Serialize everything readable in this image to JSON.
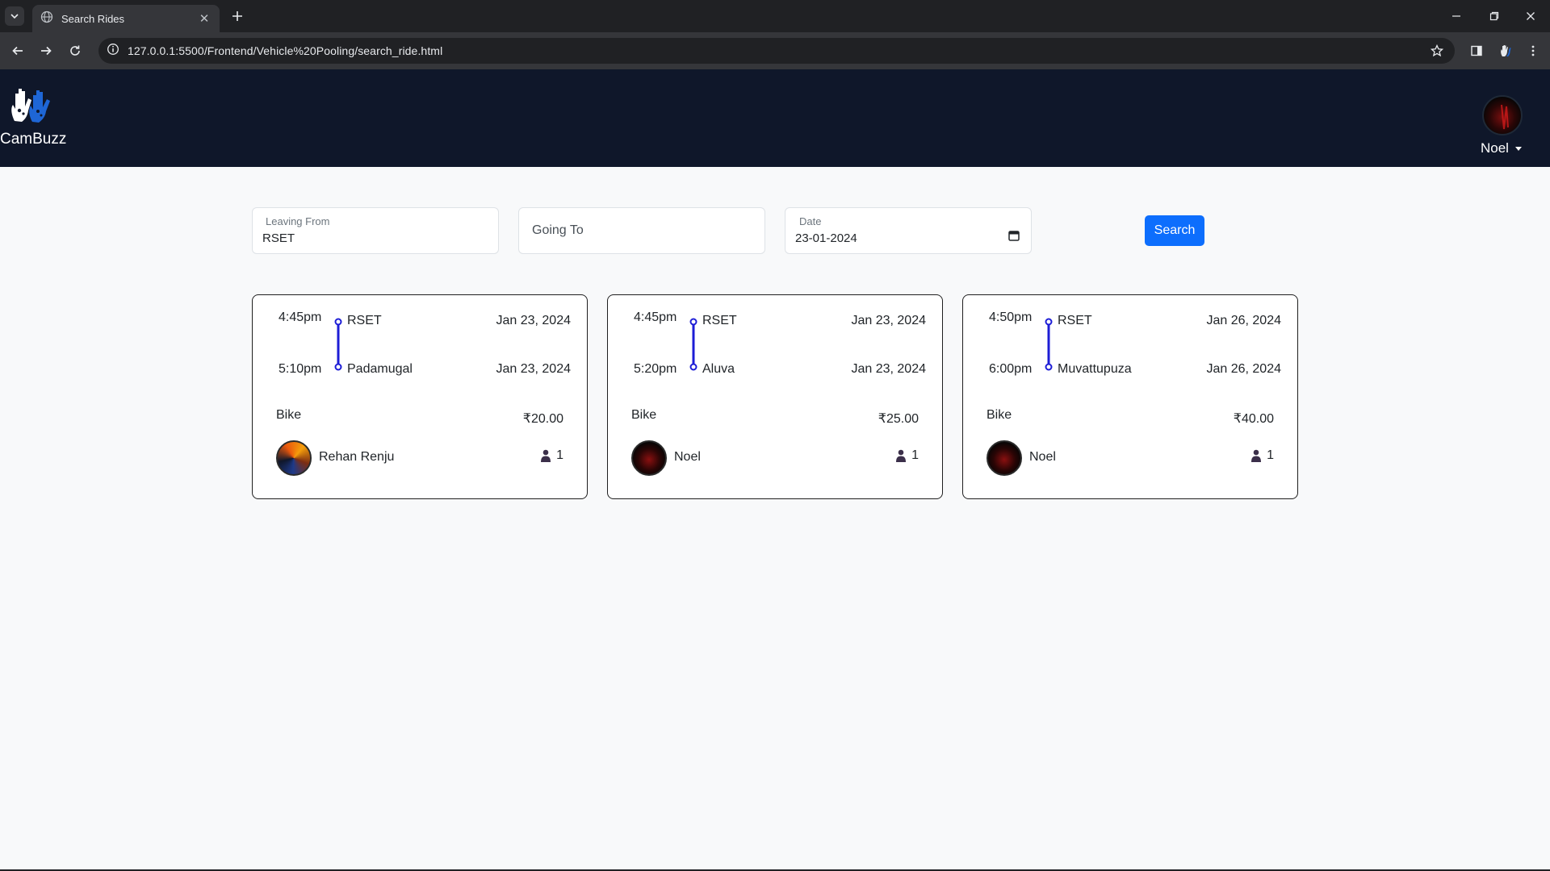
{
  "browser": {
    "tab_title": "Search Rides",
    "url": "127.0.0.1:5500/Frontend/Vehicle%20Pooling/search_ride.html"
  },
  "site": {
    "brand": "CamBuzz",
    "user_name": "Noel"
  },
  "search": {
    "leaving_from_label": "Leaving From",
    "leaving_from_value": "RSET",
    "going_to_placeholder": "Going To",
    "date_label": "Date",
    "date_value": "23-01-2024",
    "button_label": "Search"
  },
  "rides": [
    {
      "start_time": "4:45pm",
      "start_place": "RSET",
      "start_date": "Jan 23, 2024",
      "end_time": "5:10pm",
      "end_place": "Padamugal",
      "end_date": "Jan 23, 2024",
      "vehicle": "Bike",
      "price": "₹20.00",
      "driver": "Rehan Renju",
      "seats": "1"
    },
    {
      "start_time": "4:45pm",
      "start_place": "RSET",
      "start_date": "Jan 23, 2024",
      "end_time": "5:20pm",
      "end_place": "Aluva",
      "end_date": "Jan 23, 2024",
      "vehicle": "Bike",
      "price": "₹25.00",
      "driver": "Noel",
      "seats": "1"
    },
    {
      "start_time": "4:50pm",
      "start_place": "RSET",
      "start_date": "Jan 26, 2024",
      "end_time": "6:00pm",
      "end_place": "Muvattupuza",
      "end_date": "Jan 26, 2024",
      "vehicle": "Bike",
      "price": "₹40.00",
      "driver": "Noel",
      "seats": "1"
    }
  ],
  "colors": {
    "header_bg": "#0f172a",
    "accent": "#0d6efd",
    "route_line": "#1d1dd6"
  }
}
